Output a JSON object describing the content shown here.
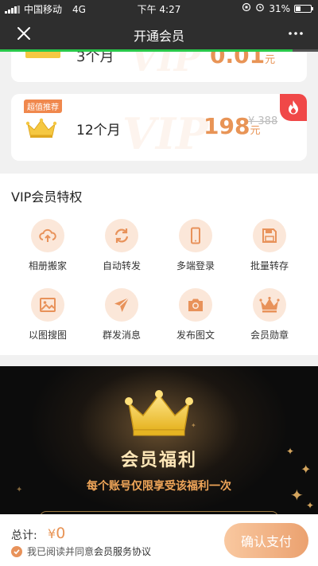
{
  "status_bar": {
    "carrier": "中国移动",
    "network": "4G",
    "time": "下午 4:27",
    "battery_percent": "31%",
    "battery_level": 0.31
  },
  "nav": {
    "title": "开通会员",
    "close_icon": "close-icon",
    "more_icon": "more-icon",
    "load_progress": 0.92
  },
  "plans": [
    {
      "duration": "3个月",
      "price": "0.01",
      "currency_unit": "元",
      "watermark": "VIP"
    },
    {
      "badge": "超值推荐",
      "duration": "12个月",
      "price": "198",
      "currency_unit": "元",
      "original_price": "¥ 388",
      "watermark": "VIP",
      "hot_icon": "flame-icon"
    }
  ],
  "privileges": {
    "heading": "VIP会员特权",
    "items": [
      {
        "label": "相册搬家",
        "icon": "cloud-upload-icon"
      },
      {
        "label": "自动转发",
        "icon": "sync-icon"
      },
      {
        "label": "多端登录",
        "icon": "phone-icon"
      },
      {
        "label": "批量转存",
        "icon": "save-icon"
      },
      {
        "label": "以图搜图",
        "icon": "image-icon"
      },
      {
        "label": "群发消息",
        "icon": "send-icon"
      },
      {
        "label": "发布图文",
        "icon": "camera-icon"
      },
      {
        "label": "会员勋章",
        "icon": "crown-icon"
      }
    ]
  },
  "benefits": {
    "title": "会员福利",
    "subtitle": "每个账号仅限享受该福利一次"
  },
  "bottom_bar": {
    "total_label": "总计:",
    "currency_symbol": "¥",
    "total_amount": "0",
    "agree_text": "我已阅读并同意",
    "agreement_link": "会员服务协议",
    "pay_button": "确认支付"
  },
  "colors": {
    "accent": "#e89456",
    "dark_bar": "#2e2e2e",
    "progress": "#29c84b",
    "hot_badge": "#f04848",
    "crown_gold": "#f5c842"
  }
}
